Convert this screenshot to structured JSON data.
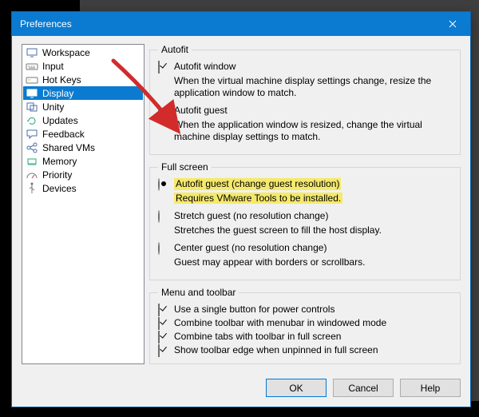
{
  "window": {
    "title": "Preferences"
  },
  "sidebar": {
    "items": [
      {
        "label": "Workspace",
        "icon": "monitor-icon"
      },
      {
        "label": "Input",
        "icon": "keyboard-icon"
      },
      {
        "label": "Hot Keys",
        "icon": "key-icon"
      },
      {
        "label": "Display",
        "icon": "display-icon",
        "selected": true
      },
      {
        "label": "Unity",
        "icon": "unity-icon"
      },
      {
        "label": "Updates",
        "icon": "refresh-icon"
      },
      {
        "label": "Feedback",
        "icon": "speech-icon"
      },
      {
        "label": "Shared VMs",
        "icon": "share-icon"
      },
      {
        "label": "Memory",
        "icon": "chip-icon"
      },
      {
        "label": "Priority",
        "icon": "gauge-icon"
      },
      {
        "label": "Devices",
        "icon": "usb-icon"
      }
    ]
  },
  "groups": {
    "autofit": {
      "legend": "Autofit",
      "window_label": "Autofit window",
      "window_desc": "When the virtual machine display settings change, resize the application window to match.",
      "guest_label": "Autofit guest",
      "guest_desc": "When the application window is resized, change the virtual machine display settings to match."
    },
    "fullscreen": {
      "legend": "Full screen",
      "opt1_label": "Autofit guest (change guest resolution)",
      "opt1_desc": "Requires VMware Tools to be installed.",
      "opt2_label": "Stretch guest (no resolution change)",
      "opt2_desc": "Stretches the guest screen to fill the host display.",
      "opt3_label": "Center guest (no resolution change)",
      "opt3_desc": "Guest may appear with borders or scrollbars."
    },
    "menu": {
      "legend": "Menu and toolbar",
      "c1": "Use a single button for power controls",
      "c2": "Combine toolbar with menubar in windowed mode",
      "c3": "Combine tabs with toolbar in full screen",
      "c4": "Show toolbar edge when unpinned in full screen"
    }
  },
  "buttons": {
    "ok": "OK",
    "cancel": "Cancel",
    "help": "Help"
  },
  "annotation": {
    "arrow_color": "#d22b2b"
  }
}
